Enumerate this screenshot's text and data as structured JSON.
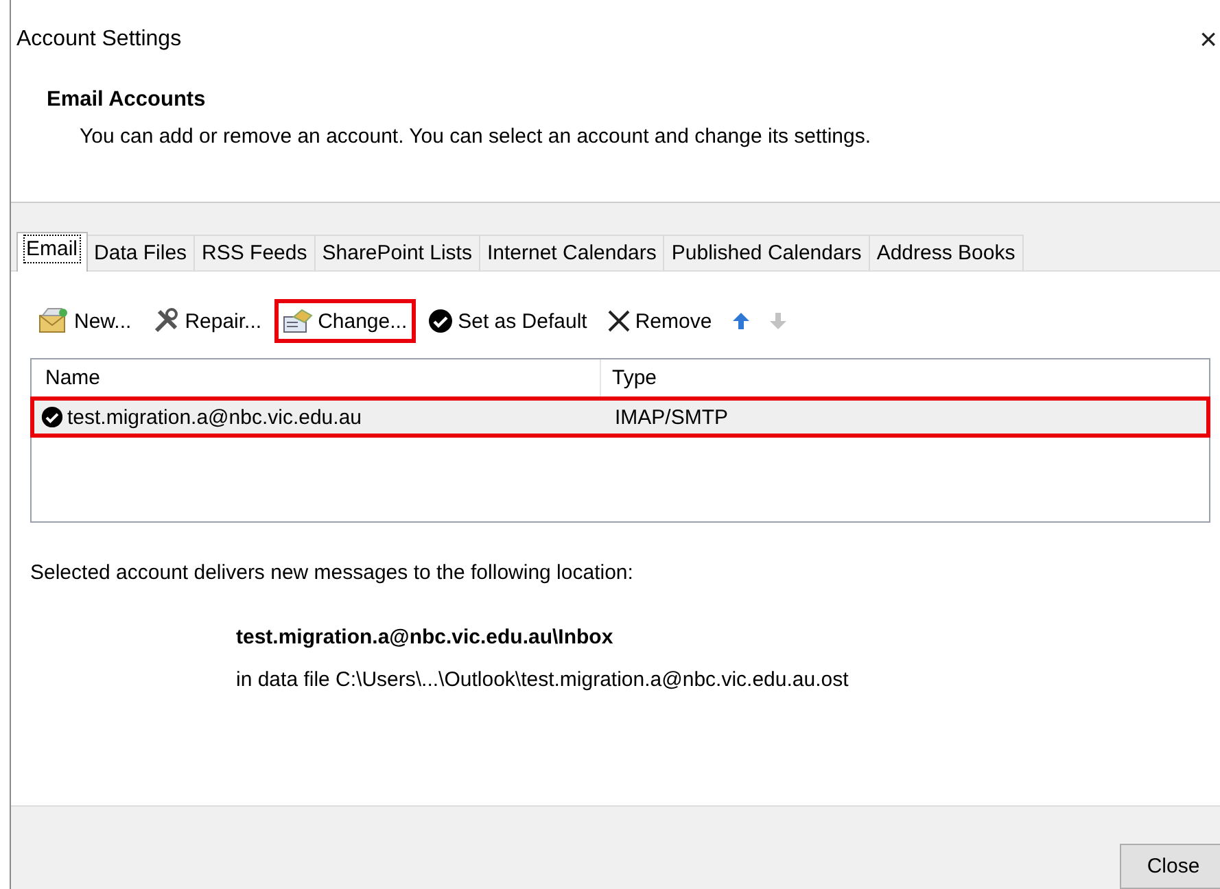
{
  "window": {
    "title": "Account Settings",
    "close": "×"
  },
  "header": {
    "title": "Email Accounts",
    "description": "You can add or remove an account. You can select an account and change its settings."
  },
  "tabs": [
    {
      "label": "Email",
      "selected": true
    },
    {
      "label": "Data Files",
      "selected": false
    },
    {
      "label": "RSS Feeds",
      "selected": false
    },
    {
      "label": "SharePoint Lists",
      "selected": false
    },
    {
      "label": "Internet Calendars",
      "selected": false
    },
    {
      "label": "Published Calendars",
      "selected": false
    },
    {
      "label": "Address Books",
      "selected": false
    }
  ],
  "toolbar": [
    {
      "kind": "new",
      "label": "New...",
      "highlighted": false,
      "disabled": false
    },
    {
      "kind": "repair",
      "label": "Repair...",
      "highlighted": false,
      "disabled": false
    },
    {
      "kind": "change",
      "label": "Change...",
      "highlighted": true,
      "disabled": false
    },
    {
      "kind": "default",
      "label": "Set as Default",
      "highlighted": false,
      "disabled": false
    },
    {
      "kind": "remove",
      "label": "Remove",
      "highlighted": false,
      "disabled": false
    },
    {
      "kind": "up",
      "highlighted": false,
      "disabled": false
    },
    {
      "kind": "down",
      "highlighted": false,
      "disabled": true
    }
  ],
  "table": {
    "columns": [
      "Name",
      "Type"
    ],
    "rows": [
      {
        "name": "test.migration.a@nbc.vic.edu.au",
        "type": "IMAP/SMTP",
        "default": true,
        "selected": true,
        "highlighted": true
      }
    ]
  },
  "delivery": {
    "intro": "Selected account delivers new messages to the following location:",
    "location": "test.migration.a@nbc.vic.edu.au\\Inbox",
    "data_file": "in data file C:\\Users\\...\\Outlook\\test.migration.a@nbc.vic.edu.au.ost"
  },
  "buttons": [
    "Close"
  ]
}
